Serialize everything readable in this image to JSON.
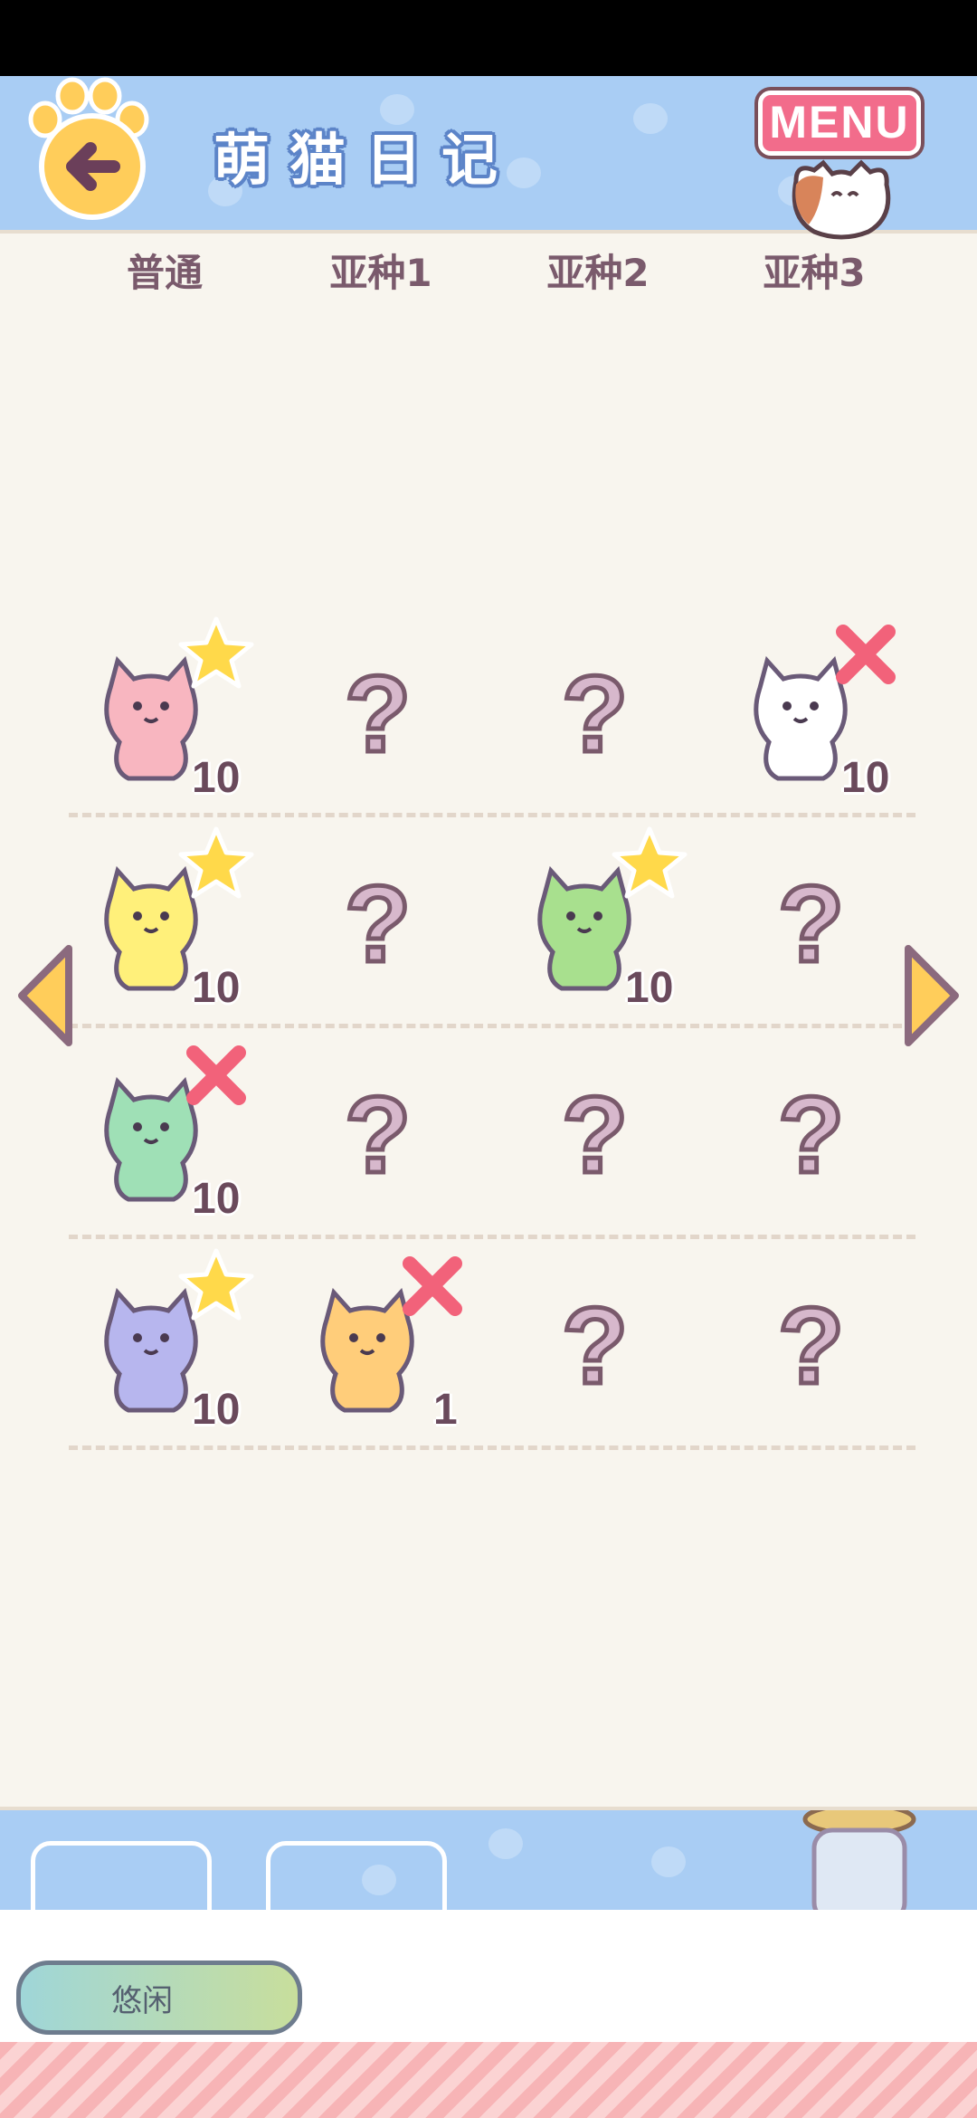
{
  "header": {
    "title": "萌猫日记",
    "menu_label": "MENU"
  },
  "tabs": [
    "普通",
    "亚种1",
    "亚种2",
    "亚种3"
  ],
  "rows": [
    {
      "cells": [
        {
          "state": "collected",
          "badge": "star",
          "count": "10",
          "icon": "pink-flower-cat-icon"
        },
        {
          "state": "unknown",
          "label": "?"
        },
        {
          "state": "unknown",
          "label": "?"
        },
        {
          "state": "collected",
          "badge": "cross",
          "count": "10",
          "icon": "white-daisy-cat-icon"
        }
      ]
    },
    {
      "cells": [
        {
          "state": "collected",
          "badge": "star",
          "count": "10",
          "icon": "yellow-sombrero-cat-icon"
        },
        {
          "state": "unknown",
          "label": "?"
        },
        {
          "state": "collected",
          "badge": "star",
          "count": "10",
          "icon": "green-sombrero-cat-icon"
        },
        {
          "state": "unknown",
          "label": "?"
        }
      ]
    },
    {
      "cells": [
        {
          "state": "collected",
          "badge": "cross",
          "count": "10",
          "icon": "green-guitar-cat-icon"
        },
        {
          "state": "unknown",
          "label": "?"
        },
        {
          "state": "unknown",
          "label": "?"
        },
        {
          "state": "unknown",
          "label": "?"
        }
      ]
    },
    {
      "cells": [
        {
          "state": "collected",
          "badge": "star",
          "count": "10",
          "icon": "purple-ninja-cat-icon"
        },
        {
          "state": "collected",
          "badge": "cross",
          "count": "1",
          "icon": "orange-ninja-cat-icon"
        },
        {
          "state": "unknown",
          "label": "?"
        },
        {
          "state": "unknown",
          "label": "?"
        }
      ]
    }
  ],
  "status": {
    "label": "悠闲"
  },
  "colors": {
    "header": "#a9cdf4",
    "background": "#f8f5ee",
    "text": "#7a5a6c",
    "star": "#ffd94a",
    "cross": "#f2627a"
  }
}
